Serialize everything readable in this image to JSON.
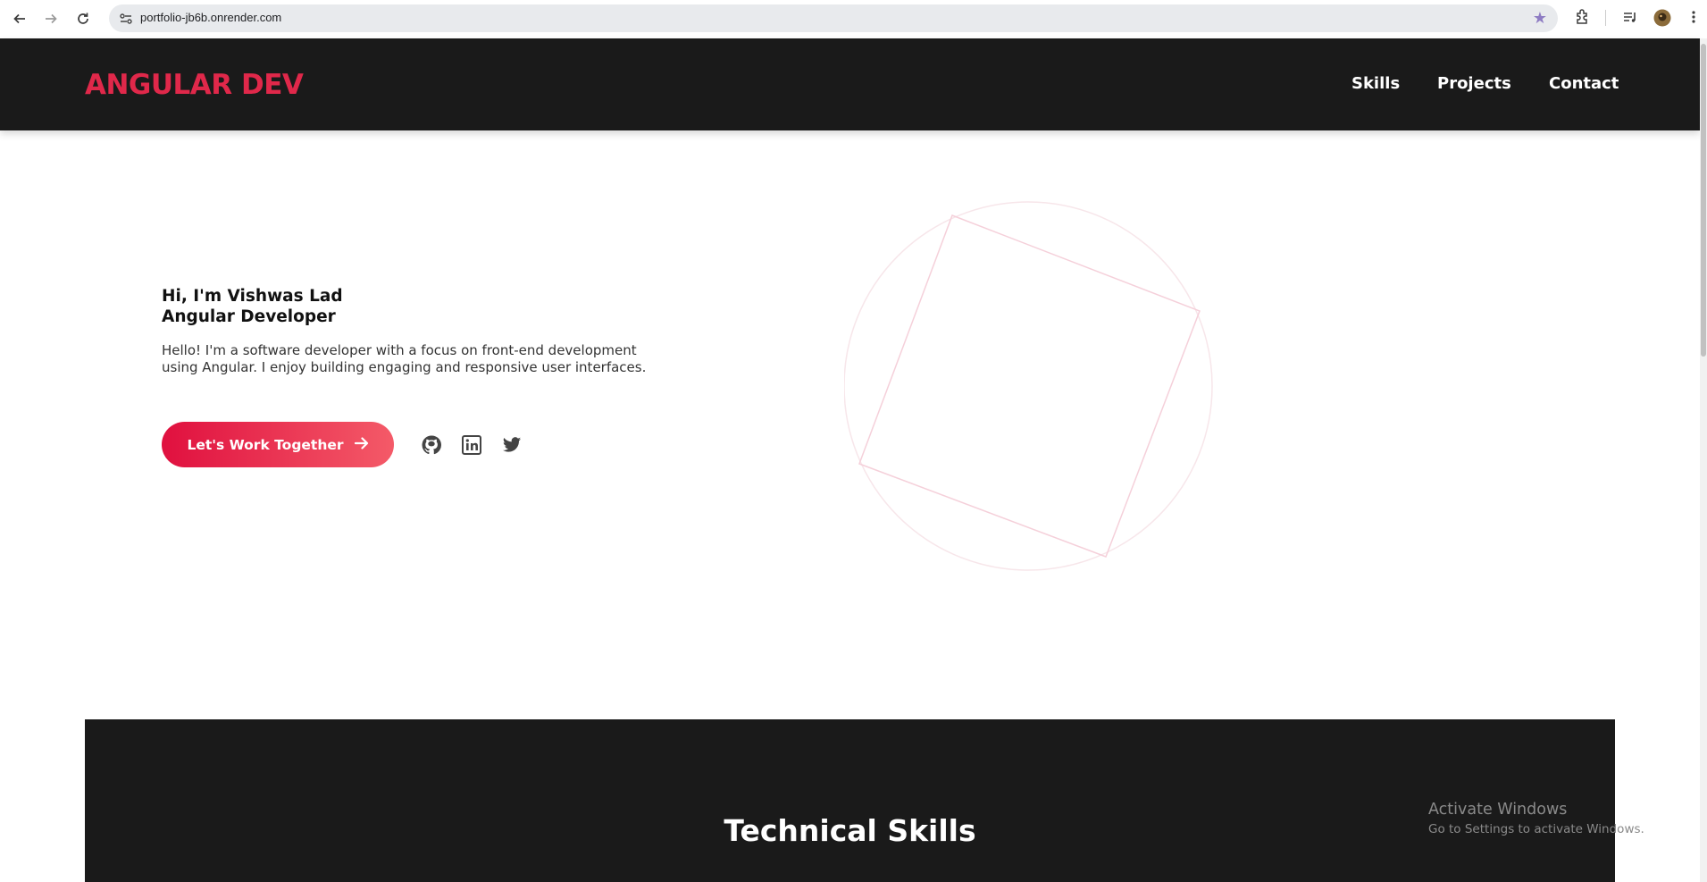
{
  "browser": {
    "url": "portfolio-jb6b.onrender.com",
    "icons": [
      "back-icon",
      "forward-icon",
      "reload-icon",
      "site-info-icon",
      "bookmark-star-icon",
      "extensions-icon",
      "media-icon",
      "profile-avatar",
      "menu-icon"
    ]
  },
  "header": {
    "logo": "ANGULAR DEV",
    "nav": [
      "Skills",
      "Projects",
      "Contact"
    ]
  },
  "hero": {
    "greeting": "Hi, I'm Vishwas Lad",
    "role": "Angular Developer",
    "description": "Hello! I'm a software developer with a focus on front-end development using Angular. I enjoy building engaging and responsive user interfaces.",
    "cta_label": "Let's Work Together",
    "social": [
      "github-icon",
      "linkedin-icon",
      "twitter-icon"
    ]
  },
  "skills": {
    "title": "Technical Skills"
  },
  "windows_notice": {
    "line1": "Activate Windows",
    "line2": "Go to Settings to activate Windows."
  },
  "colors": {
    "accent": "#e0284a",
    "header_bg": "#1a1a1a",
    "cta_start": "#e0103f",
    "cta_end": "#f45a68"
  }
}
